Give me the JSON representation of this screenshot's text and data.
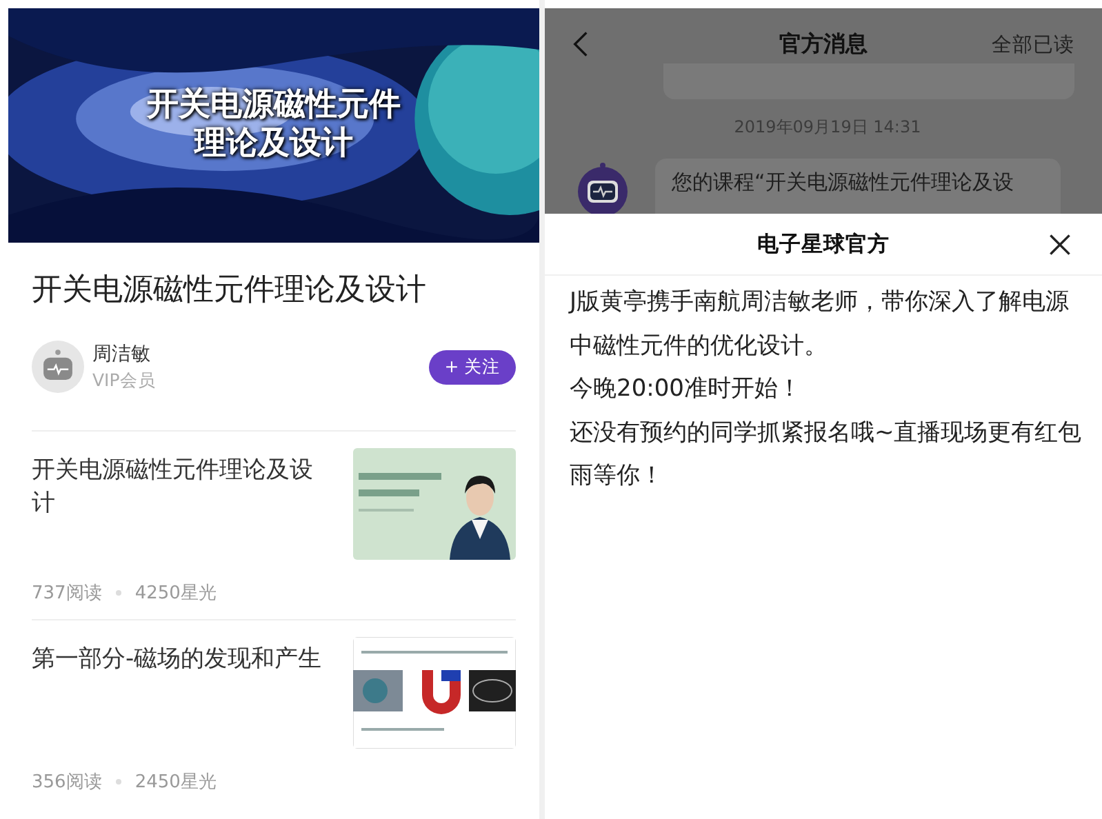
{
  "course_page": {
    "banner": {
      "kind": "picture",
      "caption": [
        "开关电源磁性元件",
        "理论及设计"
      ]
    },
    "title": "开关电源磁性元件理论及设计",
    "author": {
      "name": "周洁敏",
      "role": "VIP会员",
      "follow_button": "+ 关注"
    },
    "lessons": [
      {
        "title": "开关电源磁性元件理论及设计",
        "reads": "737阅读",
        "stars": "4250星光"
      },
      {
        "title": "第一部分-磁场的发现和产生",
        "reads": "356阅读",
        "stars": "2450星光"
      }
    ]
  },
  "messages_page": {
    "header": {
      "title": "官方消息",
      "mark_all_read": "全部已读"
    },
    "date": "2019年09月19日 14:31",
    "message_preview": "您的课程“开关电源磁性元件理论及设",
    "popup": {
      "title": "电子星球官方",
      "paragraphs": [
        "J版黄亭携手南航周洁敏老师，带你深入了解电源中磁性元件的优化设计。",
        "今晚20:00准时开始！",
        "还没有预约的同学抓紧报名哦~直播现场更有红包雨等你！"
      ]
    }
  }
}
